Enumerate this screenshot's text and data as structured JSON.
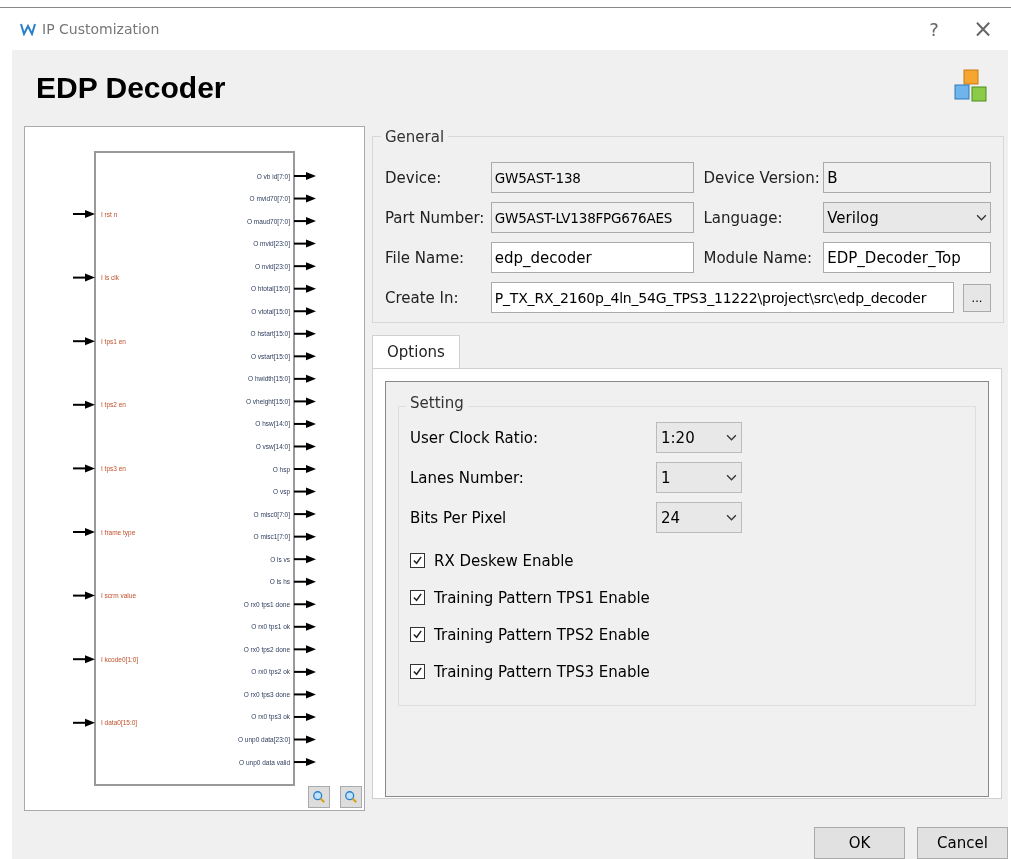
{
  "window": {
    "title": "IP Customization",
    "help": "?",
    "close": "×"
  },
  "header": {
    "title": "EDP Decoder"
  },
  "diagram": {
    "inputs": [
      "I rst n",
      "I ls clk",
      "I tps1 en",
      "I tps2 en",
      "I tps3 en",
      "I frame type",
      "I scrm value",
      "I kcode0[1:0]",
      "I data0[15:0]"
    ],
    "outputs": [
      "O vb id[7:0]",
      "O mvid70[7:0]",
      "O maud70[7:0]",
      "O mvid[23:0]",
      "O nvid[23:0]",
      "O htotal[15:0]",
      "O vtotal[15:0]",
      "O hstart[15:0]",
      "O vstart[15:0]",
      "O hwidth[15:0]",
      "O vheight[15:0]",
      "O hsw[14:0]",
      "O vsw[14:0]",
      "O hsp",
      "O vsp",
      "O misc0[7:0]",
      "O misc1[7:0]",
      "O ls vs",
      "O ls hs",
      "O rx0 tps1 done",
      "O rx0 tps1 ok",
      "O rx0 tps2 done",
      "O rx0 tps2 ok",
      "O rx0 tps3 done",
      "O rx0 tps3 ok",
      "O unp0 data[23:0]",
      "O unp0 data valid"
    ]
  },
  "general": {
    "title": "General",
    "rows": [
      {
        "fields": [
          {
            "label": "Device:",
            "value": "GW5AST-138",
            "kind": "readonly"
          },
          {
            "label": "Device Version:",
            "value": "B",
            "kind": "readonly"
          }
        ]
      },
      {
        "fields": [
          {
            "label": "Part Number:",
            "value": "GW5AST-LV138FPG676AES",
            "kind": "readonly"
          },
          {
            "label": "Language:",
            "value": "Verilog",
            "kind": "select"
          }
        ]
      },
      {
        "fields": [
          {
            "label": "File Name:",
            "value": "edp_decoder",
            "kind": "text"
          },
          {
            "label": "Module Name:",
            "value": "EDP_Decoder_Top",
            "kind": "text"
          }
        ]
      },
      {
        "fields": [
          {
            "label": "Create In:",
            "value": "P_TX_RX_2160p_4ln_54G_TPS3_11222\\project\\src\\edp_decoder",
            "kind": "path",
            "button": "..."
          }
        ]
      }
    ]
  },
  "tabs": [
    {
      "label": "Options",
      "selected": true
    }
  ],
  "setting": {
    "title": "Setting",
    "selects": [
      {
        "label": "User Clock Ratio:",
        "value": "1:20"
      },
      {
        "label": "Lanes Number:",
        "value": "1"
      },
      {
        "label": "Bits Per Pixel",
        "value": "24"
      }
    ],
    "checkboxes": [
      {
        "label": "RX Deskew Enable",
        "checked": true
      },
      {
        "label": "Training Pattern TPS1 Enable",
        "checked": true
      },
      {
        "label": "Training Pattern TPS2 Enable",
        "checked": true
      },
      {
        "label": "Training Pattern TPS3 Enable",
        "checked": true
      }
    ]
  },
  "buttons": [
    "OK",
    "Cancel"
  ]
}
